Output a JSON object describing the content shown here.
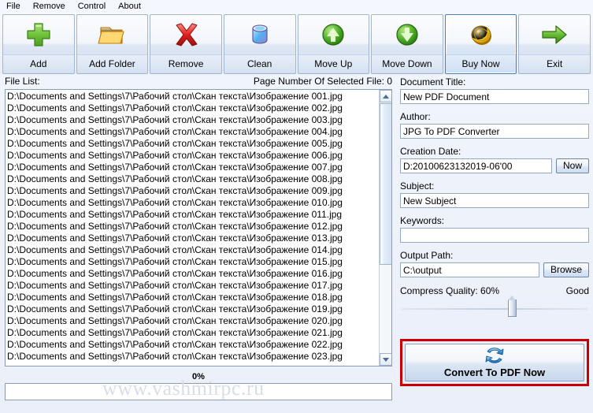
{
  "menu": {
    "items": [
      {
        "label": "File",
        "name": "menu-file"
      },
      {
        "label": "Remove",
        "name": "menu-remove"
      },
      {
        "label": "Control",
        "name": "menu-control"
      },
      {
        "label": "About",
        "name": "menu-about"
      }
    ]
  },
  "toolbar": {
    "buttons": [
      {
        "label": "Add",
        "icon": "plus-icon",
        "selected": false
      },
      {
        "label": "Add Folder",
        "icon": "folder-icon",
        "selected": false
      },
      {
        "label": "Remove",
        "icon": "cross-icon",
        "selected": false
      },
      {
        "label": "Clean",
        "icon": "bucket-icon",
        "selected": false
      },
      {
        "label": "Move Up",
        "icon": "arrow-up-circle-icon",
        "selected": false
      },
      {
        "label": "Move Down",
        "icon": "arrow-down-circle-icon",
        "selected": false
      },
      {
        "label": "Buy Now",
        "icon": "coin-icon",
        "selected": true
      },
      {
        "label": "Exit",
        "icon": "arrow-right-icon",
        "selected": false
      }
    ]
  },
  "left_panel": {
    "file_list_label": "File List:",
    "page_number_label": "Page Number Of Selected File: 0",
    "files": [
      "D:\\Documents and Settings\\7\\Рабочий стол\\Скан текста\\Изображение 001.jpg",
      "D:\\Documents and Settings\\7\\Рабочий стол\\Скан текста\\Изображение 002.jpg",
      "D:\\Documents and Settings\\7\\Рабочий стол\\Скан текста\\Изображение 003.jpg",
      "D:\\Documents and Settings\\7\\Рабочий стол\\Скан текста\\Изображение 004.jpg",
      "D:\\Documents and Settings\\7\\Рабочий стол\\Скан текста\\Изображение 005.jpg",
      "D:\\Documents and Settings\\7\\Рабочий стол\\Скан текста\\Изображение 006.jpg",
      "D:\\Documents and Settings\\7\\Рабочий стол\\Скан текста\\Изображение 007.jpg",
      "D:\\Documents and Settings\\7\\Рабочий стол\\Скан текста\\Изображение 008.jpg",
      "D:\\Documents and Settings\\7\\Рабочий стол\\Скан текста\\Изображение 009.jpg",
      "D:\\Documents and Settings\\7\\Рабочий стол\\Скан текста\\Изображение 010.jpg",
      "D:\\Documents and Settings\\7\\Рабочий стол\\Скан текста\\Изображение 011.jpg",
      "D:\\Documents and Settings\\7\\Рабочий стол\\Скан текста\\Изображение 012.jpg",
      "D:\\Documents and Settings\\7\\Рабочий стол\\Скан текста\\Изображение 013.jpg",
      "D:\\Documents and Settings\\7\\Рабочий стол\\Скан текста\\Изображение 014.jpg",
      "D:\\Documents and Settings\\7\\Рабочий стол\\Скан текста\\Изображение 015.jpg",
      "D:\\Documents and Settings\\7\\Рабочий стол\\Скан текста\\Изображение 016.jpg",
      "D:\\Documents and Settings\\7\\Рабочий стол\\Скан текста\\Изображение 017.jpg",
      "D:\\Documents and Settings\\7\\Рабочий стол\\Скан текста\\Изображение 018.jpg",
      "D:\\Documents and Settings\\7\\Рабочий стол\\Скан текста\\Изображение 019.jpg",
      "D:\\Documents and Settings\\7\\Рабочий стол\\Скан текста\\Изображение 020.jpg",
      "D:\\Documents and Settings\\7\\Рабочий стол\\Скан текста\\Изображение 021.jpg",
      "D:\\Documents and Settings\\7\\Рабочий стол\\Скан текста\\Изображение 022.jpg",
      "D:\\Documents and Settings\\7\\Рабочий стол\\Скан текста\\Изображение 023.jpg"
    ],
    "progress_percent_label": "0%",
    "progress_value": 0
  },
  "right_panel": {
    "document_title_label": "Document Title:",
    "document_title_value": "New PDF Document",
    "author_label": "Author:",
    "author_value": "JPG To PDF Converter",
    "creation_date_label": "Creation Date:",
    "creation_date_value": "D:20100623132019-06'00",
    "now_button_label": "Now",
    "subject_label": "Subject:",
    "subject_value": "New Subject",
    "keywords_label": "Keywords:",
    "keywords_value": "",
    "keywords_placeholder": "",
    "output_path_label": "Output Path:",
    "output_path_value": "C:\\output",
    "browse_button_label": "Browse",
    "compress_quality_label": "Compress Quality: 60%",
    "compress_quality_value": 60,
    "compress_quality_rating": "Good",
    "convert_button_label": "Convert To PDF Now",
    "convert_button_icon": "convert-refresh-icon"
  },
  "watermark": {
    "text": "www.vashmirpc.ru"
  },
  "colors": {
    "accent": "#4a7ebb",
    "highlight_box": "#cc0000",
    "panel_bg": "#eef2fa"
  }
}
